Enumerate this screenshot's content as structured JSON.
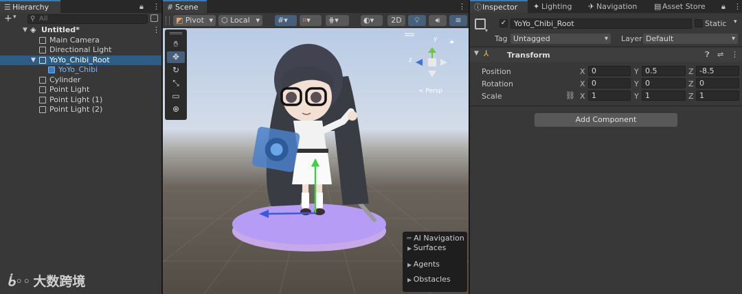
{
  "hierarchy": {
    "tab": "Hierarchy",
    "search_placeholder": "All",
    "scene_name": "Untitled*",
    "items": [
      {
        "label": "Main Camera"
      },
      {
        "label": "Directional Light"
      },
      {
        "label": "YoYo_Chibi_Root"
      },
      {
        "label": "YoYo_Chibi"
      },
      {
        "label": "Cylinder"
      },
      {
        "label": "Point Light"
      },
      {
        "label": "Point Light (1)"
      },
      {
        "label": "Point Light (2)"
      }
    ]
  },
  "scene": {
    "tab": "Scene",
    "pivot": "Pivot",
    "local": "Local",
    "mode_2d": "2D",
    "gizmo_labels": {
      "y": "y",
      "z": "z",
      "persp": "< Persp"
    },
    "nav_overlay": {
      "title": "AI Navigation",
      "items": [
        "Surfaces",
        "Agents",
        "Obstacles"
      ]
    }
  },
  "inspector": {
    "tabs": [
      "Inspector",
      "Lighting",
      "Navigation",
      "Asset Store"
    ],
    "object_name": "YoYo_Chibi_Root",
    "static_label": "Static",
    "tag_label": "Tag",
    "tag_value": "Untagged",
    "layer_label": "Layer",
    "layer_value": "Default",
    "component": "Transform",
    "position": {
      "label": "Position",
      "x": "0",
      "y": "0.5",
      "z": "-8.5"
    },
    "rotation": {
      "label": "Rotation",
      "x": "0",
      "y": "0",
      "z": "0"
    },
    "scale": {
      "label": "Scale",
      "x": "1",
      "y": "1",
      "z": "1"
    },
    "add_component": "Add Component"
  },
  "watermark": "大数跨境",
  "colors": {
    "accent": "#3a79bb",
    "selection": "#2c5d87",
    "panel": "#383838"
  }
}
